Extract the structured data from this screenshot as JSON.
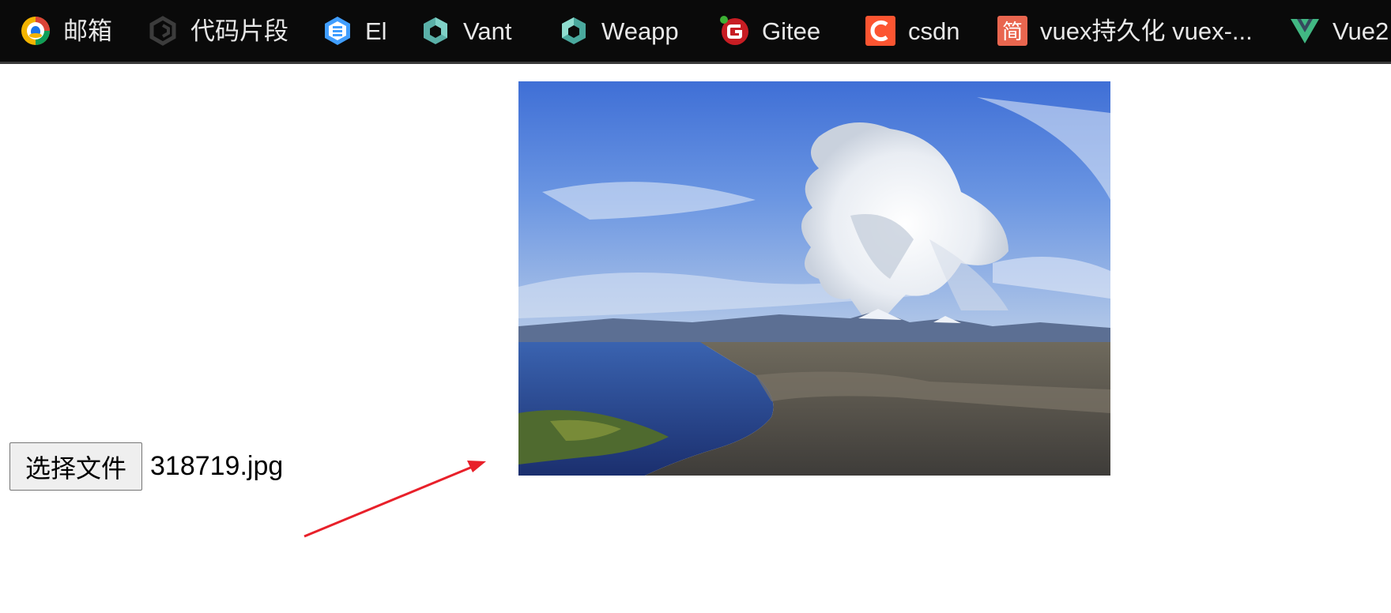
{
  "bookmarks_bar": {
    "items": [
      {
        "label": "邮箱",
        "icon": "qq-mail-icon"
      },
      {
        "label": "代码片段",
        "icon": "code-snippet-icon"
      },
      {
        "label": "El",
        "icon": "element-ui-icon"
      },
      {
        "label": "Vant",
        "icon": "vant-icon"
      },
      {
        "label": "Weapp",
        "icon": "weapp-icon"
      },
      {
        "label": "Gitee",
        "icon": "gitee-icon"
      },
      {
        "label": "csdn",
        "icon": "csdn-icon"
      },
      {
        "label": "vuex持久化 vuex-...",
        "icon": "jianshu-icon"
      },
      {
        "label": "Vue2",
        "icon": "vue-icon"
      }
    ]
  },
  "file_input": {
    "button_label": "选择文件",
    "file_name": "318719.jpg"
  },
  "preview": {
    "subject": "volcano-eruption-photo"
  },
  "annotation": {
    "arrow_color": "#e8202a"
  }
}
